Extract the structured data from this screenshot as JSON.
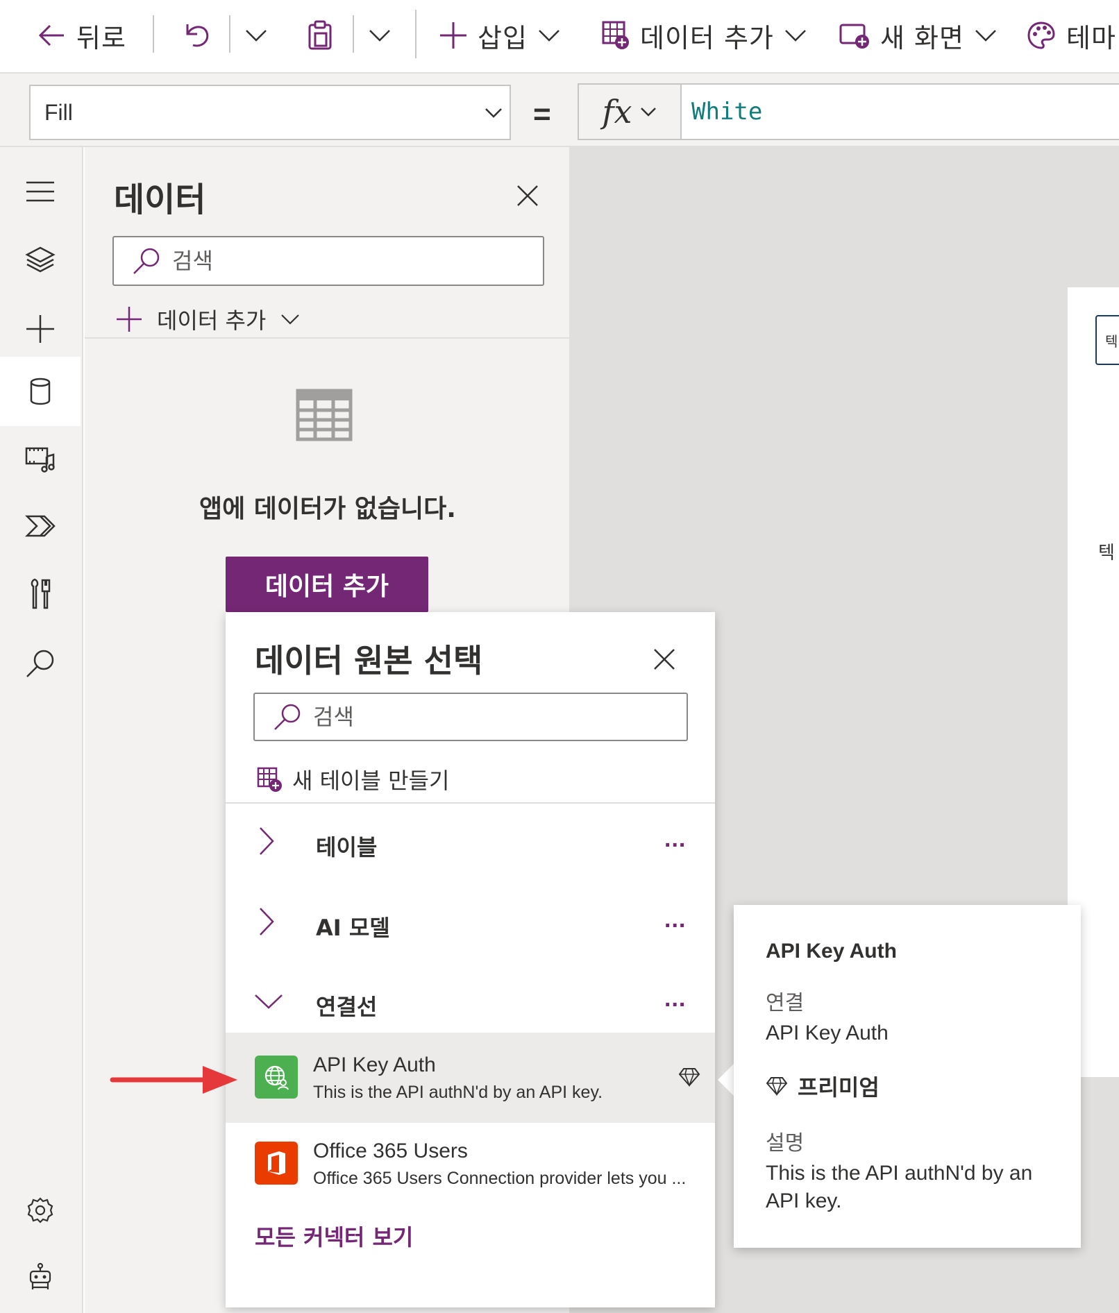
{
  "commandbar": {
    "back_label": "뒤로",
    "insert_label": "삽입",
    "add_data_label": "데이터 추가",
    "new_screen_label": "새 화면",
    "theme_label": "테마"
  },
  "formulabar": {
    "property": "Fill",
    "equals": "=",
    "formula": "White"
  },
  "data_pane": {
    "title": "데이터",
    "search_placeholder": "검색",
    "add_data_label": "데이터 추가",
    "empty_text": "앱에 데이터가 없습니다.",
    "add_data_button": "데이터 추가"
  },
  "flyout": {
    "title": "데이터 원본 선택",
    "search_placeholder": "검색",
    "new_table_label": "새 테이블 만들기",
    "groups": [
      {
        "label": "테이블",
        "expanded": false
      },
      {
        "label": "AI 모델",
        "expanded": false
      },
      {
        "label": "연결선",
        "expanded": true
      }
    ],
    "more_glyph": "...",
    "connectors": [
      {
        "name": "API Key Auth",
        "description": "This is the API authN'd by an API key.",
        "premium": true,
        "logo_color": "#4caf50",
        "icon": "globe-person-icon"
      },
      {
        "name": "Office 365 Users",
        "description": "Office 365 Users Connection provider lets you ...",
        "premium": false,
        "logo_color": "#eb3c00",
        "icon": "office-icon"
      }
    ],
    "see_all_label": "모든 커넥터 보기"
  },
  "callout": {
    "heading": "API Key Auth",
    "connection_key": "연결",
    "connection_value": "API Key Auth",
    "premium_label": "프리미엄",
    "description_key": "설명",
    "description_value_line1": "This is the API authN'd by an",
    "description_value_line2": "API key."
  },
  "canvas": {
    "input_partial_text": "텍",
    "label_partial_text": "텍"
  },
  "colors": {
    "accent": "#742774",
    "annotation_arrow": "#e5383b",
    "formula_text": "#107c7c"
  }
}
